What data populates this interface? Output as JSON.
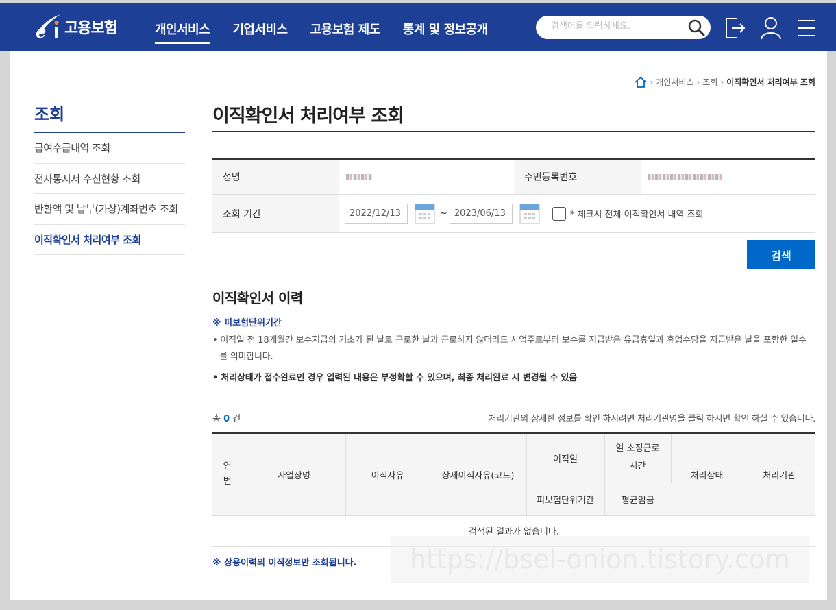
{
  "header": {
    "logo_text": "고용보험",
    "nav": [
      "개인서비스",
      "기업서비스",
      "고용보험 제도",
      "통계 및 정보공개"
    ],
    "search_placeholder": "검색어를 입력하세요."
  },
  "breadcrumb": [
    "개인서비스",
    "조회",
    "이직확인서 처리여부 조회"
  ],
  "sidebar": {
    "title": "조회",
    "items": [
      {
        "label": "급여수급내역 조회"
      },
      {
        "label": "전자통지서 수신현황 조회"
      },
      {
        "label": "반환액 및 납부(가상)계좌번호 조회"
      },
      {
        "label": "이직확인서 처리여부 조회"
      }
    ]
  },
  "page_title": "이직확인서 처리여부 조회",
  "form": {
    "name_label": "성명",
    "rrn_label": "주민등록번호",
    "period_label": "조회 기간",
    "start_date": "2022/12/13",
    "tilde": "~",
    "end_date": "2023/06/13",
    "checkbox_label": "* 체크시 전체 이직확인서 내역 조회",
    "search_button": "검색"
  },
  "history": {
    "title": "이직확인서 이력",
    "note_head": "※ 피보험단위기간",
    "note_text": "• 이직일 전 18개월간 보수지급의 기초가 된 날로 근로한 날과 근로하지 않더라도 사업주로부터 보수를 지급받은 유급휴일과 휴업수당을 지급받은 날을 포함한 일수를 의미합니다.",
    "note_bold": "• 처리상태가 접수완료인 경우 입력된 내용은 부정확할 수 있으며, 최종 처리완료 시 변경될 수 있음",
    "count_prefix": "총",
    "count": "0",
    "count_suffix": "건",
    "count_hint": "처리기관의 상세한 정보를 확인 하시려면 처리기관명을 클릭 하시면 확인 하실 수 있습니다.",
    "columns": {
      "no_line1": "연",
      "no_line2": "번",
      "company": "사업장명",
      "reason": "이직사유",
      "detail_reason": "상세이직사유(코드)",
      "leave_date": "이직일",
      "insured_period": "피보험단위기간",
      "work_hours_line1": "일 소정근로",
      "work_hours_line2": "시간",
      "avg_wage": "평균임금",
      "status": "처리상태",
      "agency": "처리기관"
    },
    "empty_text": "검색된 결과가 없습니다.",
    "foot_note": "※ 상용이력의 이직정보만 조회됩니다."
  },
  "watermark": "https://bsel-onion.tistory.com"
}
